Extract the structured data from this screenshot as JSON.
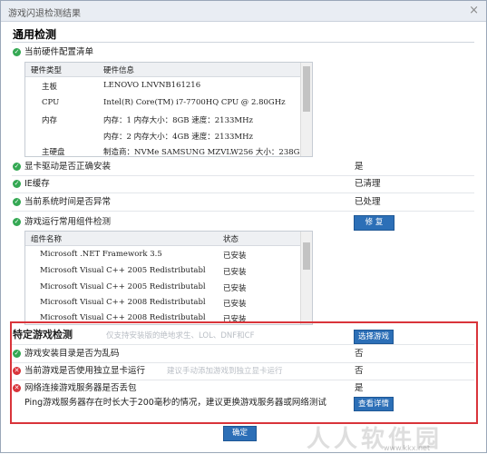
{
  "window": {
    "title": "游戏闪退检测结果",
    "close_glyph": "×"
  },
  "general": {
    "heading": "通用检测",
    "hardware_list_label": "当前硬件配置清单",
    "hardware_table": {
      "headers": [
        "硬件类型",
        "硬件信息"
      ],
      "rows": [
        [
          "主板",
          "LENOVO LNVNB161216"
        ],
        [
          "CPU",
          "Intel(R) Core(TM) i7-7700HQ CPU @ 2.80GHz"
        ],
        [
          "内存",
          "内存：1 内存大小：8GB 速度：2133MHz"
        ],
        [
          "",
          "内存：2 内存大小：4GB 速度：2133MHz"
        ],
        [
          "主硬盘",
          "制造商：NVMe SAMSUNG MZVLW256 大小：238GB"
        ]
      ]
    },
    "checks": [
      {
        "label": "显卡驱动是否正确安装",
        "value": "是"
      },
      {
        "label": "IE缓存",
        "value": "已清理"
      },
      {
        "label": "当前系统时间是否异常",
        "value": "已处理"
      }
    ],
    "components_label": "游戏运行常用组件检测",
    "repair_button": "修 复",
    "components_table": {
      "headers": [
        "组件名称",
        "状态"
      ],
      "rows": [
        [
          "Microsoft .NET Framework 3.5",
          "已安装"
        ],
        [
          "Microsoft Visual C++ 2005 Redistributabl",
          "已安装"
        ],
        [
          "Microsoft Visual C++ 2005 Redistributabl",
          "已安装"
        ],
        [
          "Microsoft Visual C++ 2008 Redistributabl",
          "已安装"
        ],
        [
          "Microsoft Visual C++ 2008 Redistributabl",
          "已安装"
        ]
      ]
    }
  },
  "specific": {
    "heading": "特定游戏检测",
    "hint": "仅支持安装版的绝地求生、LOL、DNF和CF",
    "select_game_button": "选择游戏",
    "checks": [
      {
        "status": "ok",
        "label": "游戏安装目录是否为乱码",
        "hint": "",
        "value": "否"
      },
      {
        "status": "err",
        "label": "当前游戏是否使用独立显卡运行",
        "hint": "建议手动添加游戏到独立显卡运行",
        "value": "否"
      },
      {
        "status": "err",
        "label": "网络连接游戏服务器是否丢包",
        "hint": "",
        "value": "是"
      }
    ],
    "ping_message": "Ping游戏服务器存在时长大于200毫秒的情况，建议更换游戏服务器或网络测试",
    "details_button": "查看详情"
  },
  "ok_button": "确定",
  "watermark": {
    "text": "人人软件园",
    "site": "www.kkx.net"
  },
  "colors": {
    "ok": "#34a853",
    "error": "#d9343a",
    "button": "#2c6fb7",
    "highlight_border": "#d9343a"
  }
}
